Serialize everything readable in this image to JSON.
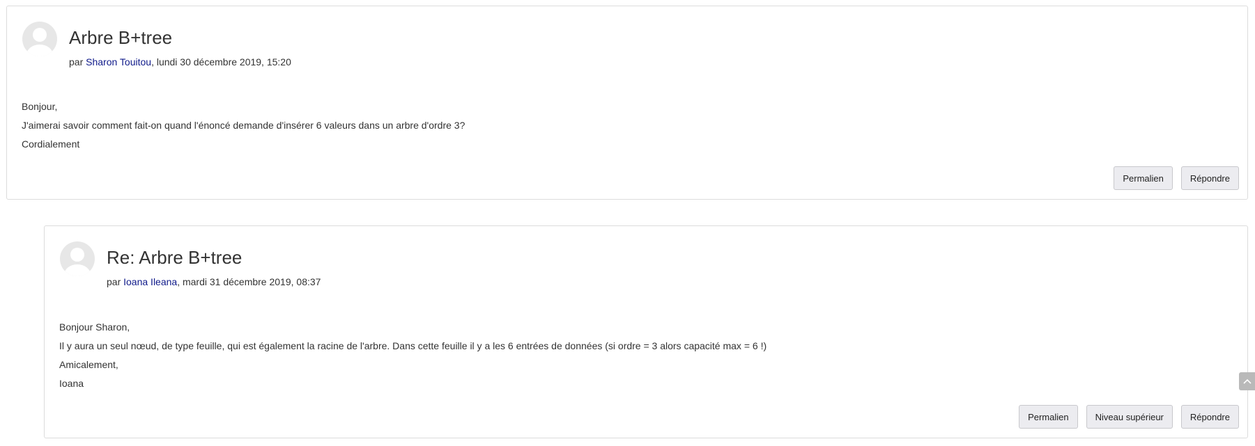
{
  "posts": [
    {
      "subject": "Arbre B+tree",
      "by_prefix": "par ",
      "author": "Sharon Touitou",
      "date": ", lundi 30 décembre 2019, 15:20",
      "content": [
        "Bonjour,",
        "J'aimerai savoir comment fait-on quand l'énoncé demande d'insérer 6 valeurs dans un arbre d'ordre 3?",
        "Cordialement"
      ],
      "actions": {
        "permalink": "Permalien",
        "reply": "Répondre"
      }
    },
    {
      "subject": "Re: Arbre B+tree",
      "by_prefix": "par ",
      "author": "Ioana Ileana",
      "date": ", mardi 31 décembre 2019, 08:37",
      "content": [
        "Bonjour Sharon,",
        "Il y aura un seul nœud, de type feuille, qui est également la racine de l'arbre. Dans cette feuille il y a les 6 entrées de données (si ordre = 3 alors capacité max = 6 !)",
        "Amicalement,",
        "Ioana"
      ],
      "actions": {
        "permalink": "Permalien",
        "parent": "Niveau supérieur",
        "reply": "Répondre"
      }
    }
  ],
  "icons": {
    "avatar": "user-avatar-icon",
    "scroll_top": "chevron-up-icon"
  },
  "colors": {
    "link": "#0f1a8a",
    "button_bg": "#ececf0",
    "border": "#dcdcdc"
  }
}
